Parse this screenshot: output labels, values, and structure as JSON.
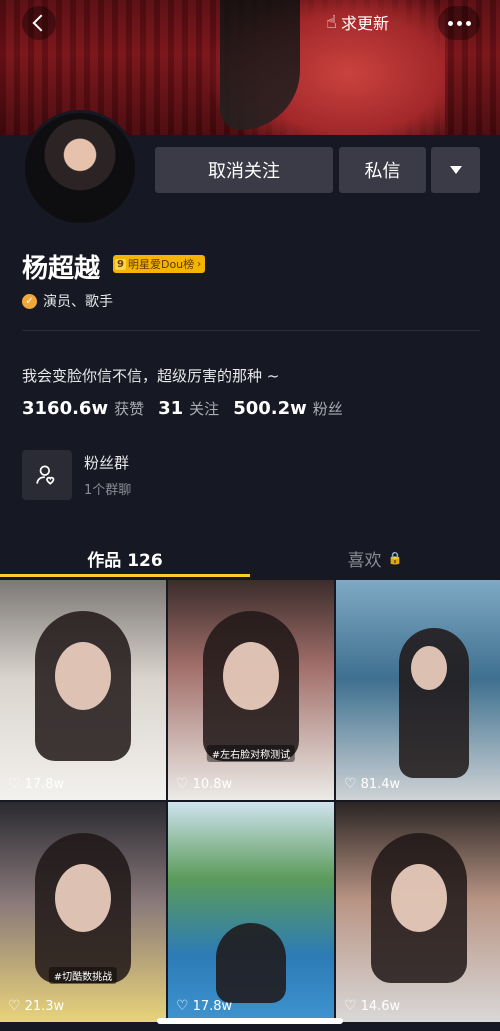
{
  "header": {
    "update_label": "求更新"
  },
  "profile": {
    "name": "杨超越",
    "rank_badge": {
      "number": "9",
      "label": "明星爱Dou榜"
    },
    "verification": "演员、歌手",
    "bio": "我会变脸你信不信，超级厉害的那种 ~",
    "stats": [
      {
        "value": "3160.6w",
        "label": "获赞"
      },
      {
        "value": "31",
        "label": "关注"
      },
      {
        "value": "500.2w",
        "label": "粉丝"
      }
    ]
  },
  "actions": {
    "unfollow_label": "取消关注",
    "message_label": "私信"
  },
  "fans_group": {
    "title": "粉丝群",
    "subtitle": "1个群聊"
  },
  "tabs": {
    "works": "作品 126",
    "likes": "喜欢"
  },
  "videos": [
    {
      "likes": "17.8w",
      "sticker": ""
    },
    {
      "likes": "10.8w",
      "sticker": "#左右脸对称测试"
    },
    {
      "likes": "81.4w",
      "sticker": ""
    },
    {
      "likes": "21.3w",
      "sticker": "#切酷数挑战"
    },
    {
      "likes": "17.8w",
      "sticker": ""
    },
    {
      "likes": "14.6w",
      "sticker": ""
    }
  ],
  "colors": {
    "background": "#161823",
    "button": "#3a3b46",
    "tab_underline": "#facd2c",
    "badge": "#f4b400",
    "verify": "#f2a73b"
  }
}
